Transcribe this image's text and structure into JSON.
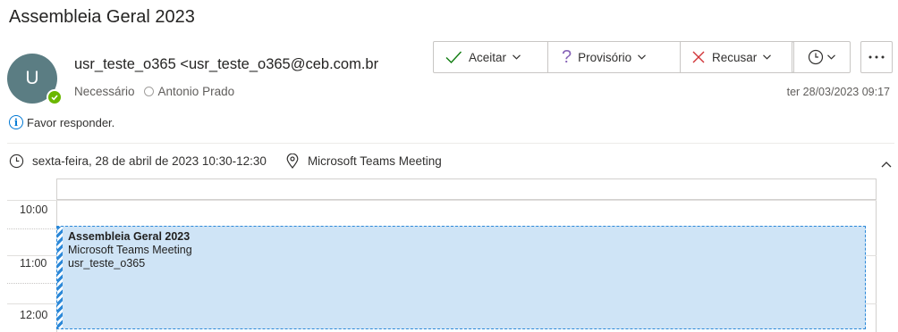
{
  "title": "Assembleia Geral 2023",
  "sender": {
    "avatar_initial": "U",
    "display": "usr_teste_o365 <usr_teste_o365@ceb.com.br",
    "presence_color": "#6bb700"
  },
  "attendees": {
    "required_label": "Necessário",
    "names": [
      "Antonio Prado"
    ]
  },
  "sent_date": "ter 28/03/2023 09:17",
  "actions": {
    "accept": "Aceitar",
    "tentative": "Provisório",
    "decline": "Recusar",
    "accept_color": "#107c10",
    "tentative_color": "#8764b8",
    "decline_color": "#d13438"
  },
  "info_message": "Favor responder.",
  "meeting": {
    "when": "sexta-feira, 28 de abril de 2023 10:30-12:30",
    "location": "Microsoft Teams Meeting"
  },
  "calendar": {
    "times": [
      "10:00",
      "11:00",
      "12:00"
    ],
    "event": {
      "title": "Assembleia Geral 2023",
      "location": "Microsoft Teams Meeting",
      "organizer": "usr_teste_o365",
      "fill_color": "#cfe4f6",
      "border_color": "#2b88d8"
    }
  }
}
